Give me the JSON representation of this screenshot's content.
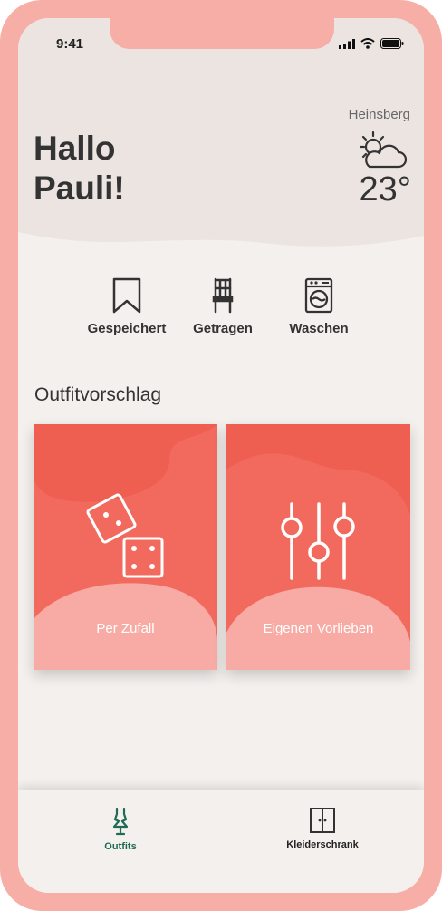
{
  "status_bar": {
    "time": "9:41"
  },
  "header": {
    "greeting_line1": "Hallo",
    "greeting_line2": "Pauli!",
    "location": "Heinsberg",
    "temperature": "23°",
    "weather_icon": "partly-cloudy-icon"
  },
  "quick_actions": [
    {
      "label": "Gespeichert",
      "icon": "bookmark-icon"
    },
    {
      "label": "Getragen",
      "icon": "chair-icon"
    },
    {
      "label": "Waschen",
      "icon": "washing-machine-icon"
    }
  ],
  "section": {
    "title": "Outfitvorschlag"
  },
  "cards": [
    {
      "label": "Per Zufall",
      "icon": "dice-icon"
    },
    {
      "label": "Eigenen Vorlieben",
      "icon": "sliders-icon"
    }
  ],
  "tabbar": [
    {
      "label": "Outfits",
      "icon": "dress-icon",
      "active": true
    },
    {
      "label": "Kleiderschrank",
      "icon": "wardrobe-icon",
      "active": false
    }
  ],
  "colors": {
    "frame": "#f7aea7",
    "accent": "#f26a5e",
    "active_tab": "#1f6b55",
    "background": "#f4f0ee"
  }
}
